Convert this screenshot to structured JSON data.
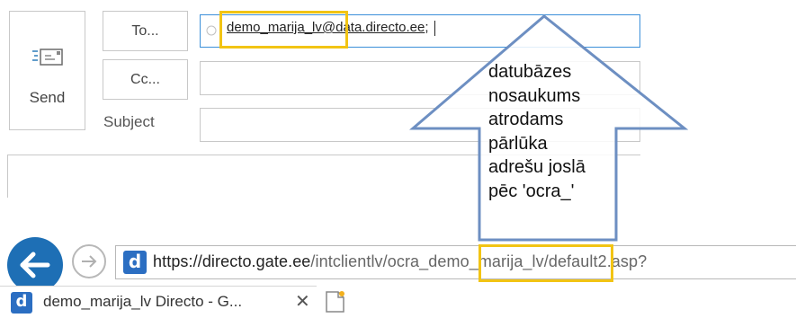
{
  "compose": {
    "send_label": "Send",
    "to_button": "To...",
    "cc_button": "Cc...",
    "subject_label": "Subject",
    "to_value": "demo_marija_lv@data.directo.ee",
    "to_separator": ";"
  },
  "annotation": {
    "line1": "datubāzes",
    "line2": "nosaukums",
    "line3": "atrodams",
    "line4": "pārlūka",
    "line5": "adrešu joslā",
    "line6": "pēc 'ocra_'",
    "highlight_color": "#f2c414",
    "arrow_color": "#6d8fc2"
  },
  "browser": {
    "url_scheme": "https://directo.",
    "url_domain": "gate.ee",
    "url_path": "/intclientlv/ocra_demo_marija_lv/default2.asp?",
    "logo_letter": "d",
    "tab_title": "demo_marija_lv Directo - G...",
    "tab_close": "✕",
    "accent_color": "#1e6fb5"
  }
}
